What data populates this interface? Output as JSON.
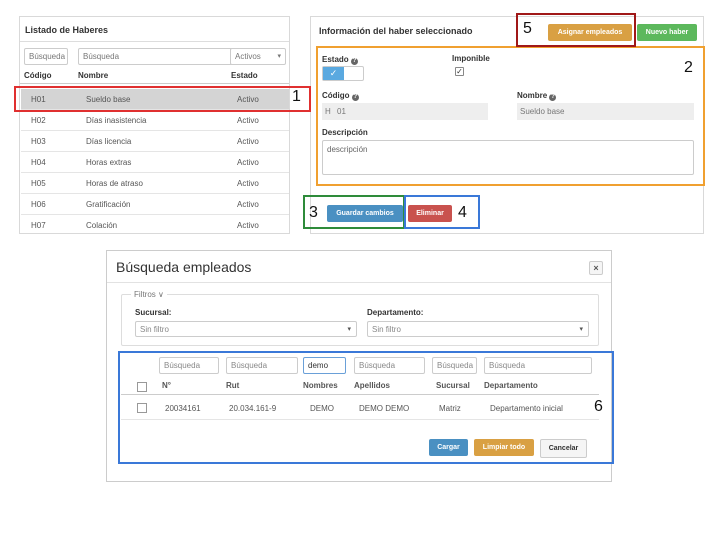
{
  "left": {
    "title": "Listado de Haberes",
    "filters": {
      "codigo_placeholder": "Búsqueda",
      "nombre_placeholder": "Búsqueda",
      "estado_value": "Activos"
    },
    "columns": [
      "Código",
      "Nombre",
      "Estado"
    ],
    "rows": [
      {
        "codigo": "H01",
        "nombre": "Sueldo base",
        "estado": "Activo"
      },
      {
        "codigo": "H02",
        "nombre": "Días inasistencia",
        "estado": "Activo"
      },
      {
        "codigo": "H03",
        "nombre": "Días licencia",
        "estado": "Activo"
      },
      {
        "codigo": "H04",
        "nombre": "Horas extras",
        "estado": "Activo"
      },
      {
        "codigo": "H05",
        "nombre": "Horas de atraso",
        "estado": "Activo"
      },
      {
        "codigo": "H06",
        "nombre": "Gratificación",
        "estado": "Activo"
      },
      {
        "codigo": "H07",
        "nombre": "Colación",
        "estado": "Activo"
      }
    ]
  },
  "right": {
    "title": "Información del haber seleccionado",
    "assign_label": "Asignar empleados",
    "new_label": "Nuevo haber",
    "estado_label": "Estado",
    "imponible_label": "Imponible",
    "codigo_label": "Código",
    "codigo_prefix": "H",
    "codigo_value": "01",
    "nombre_label": "Nombre",
    "nombre_value": "Sueldo base",
    "descripcion_label": "Descripción",
    "descripcion_value": "descripción",
    "save_label": "Guardar cambios",
    "delete_label": "Eliminar"
  },
  "annotations": {
    "n1": "1",
    "n2": "2",
    "n3": "3",
    "n4": "4",
    "n5": "5",
    "n6": "6"
  },
  "modal": {
    "title": "Búsqueda empleados",
    "close": "×",
    "filtros_legend": "Filtros ∨",
    "sucursal_label": "Sucursal:",
    "sucursal_value": "Sin filtro",
    "departamento_label": "Departamento:",
    "departamento_value": "Sin filtro",
    "filters": {
      "n_placeholder": "Búsqueda",
      "rut_placeholder": "Búsqueda",
      "nombres_value": "demo",
      "apellidos_placeholder": "Búsqueda",
      "sucursal_placeholder": "Búsqueda",
      "departamento_placeholder": "Búsqueda"
    },
    "columns": [
      "N°",
      "Rut",
      "Nombres",
      "Apellidos",
      "Sucursal",
      "Departamento"
    ],
    "row": {
      "n": "20034161",
      "rut": "20.034.161-9",
      "nombres": "DEMO",
      "apellidos": "DEMO DEMO",
      "sucursal": "Matriz",
      "departamento": "Departamento inicial"
    },
    "cargar_label": "Cargar",
    "limpiar_label": "Limpiar todo",
    "cancelar_label": "Cancelar"
  },
  "colors": {
    "red": "#e03030",
    "orange": "#f0a030",
    "green": "#2e8b3a",
    "blue": "#3a78d8",
    "darkred": "#a01818",
    "teal": "#4a90c2",
    "amber": "#d9a043",
    "btn_green": "#5cb85c",
    "btn_red": "#c9524e"
  }
}
